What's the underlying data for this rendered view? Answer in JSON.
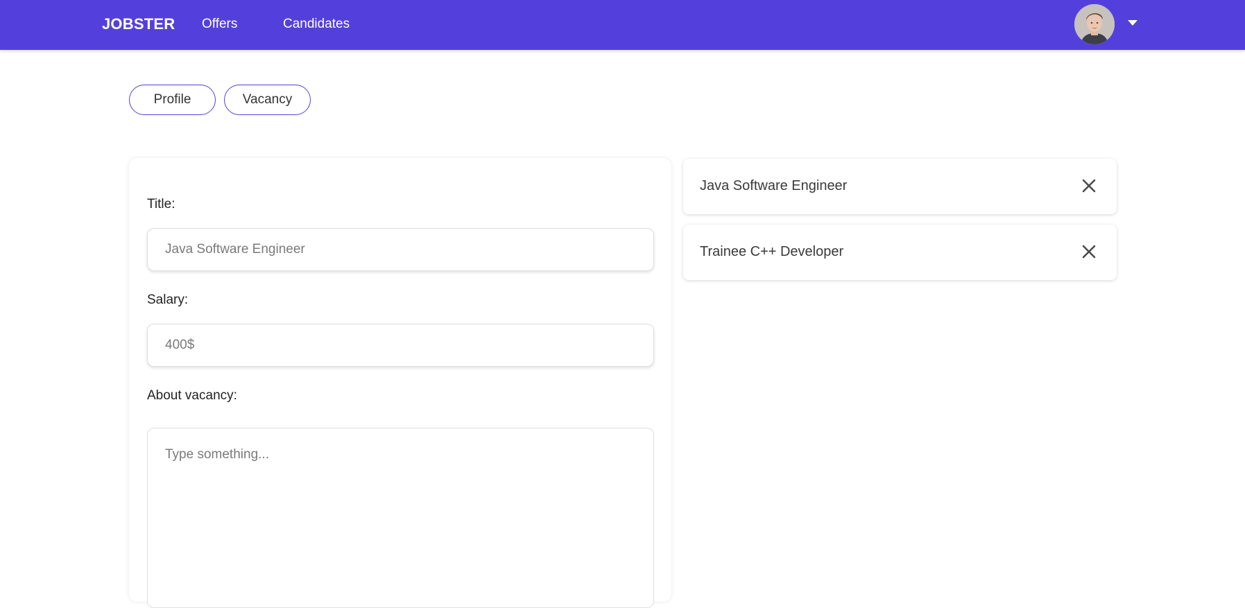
{
  "navbar": {
    "brand": "JOBSTER",
    "links": [
      "Offers",
      "Candidates"
    ],
    "accent_color": "#5340dc",
    "avatar_icon": "user-avatar",
    "menu_icon": "caret-down-icon"
  },
  "tabs": {
    "profile": "Profile",
    "vacancy": "Vacancy"
  },
  "form": {
    "title_label": "Title:",
    "title_placeholder": "Java Software Engineer",
    "salary_label": "Salary:",
    "salary_placeholder": "400$",
    "about_label": "About vacancy:",
    "about_placeholder": "Type something..."
  },
  "vacancies": [
    {
      "title": "Java Software Engineer",
      "remove_icon": "close-icon"
    },
    {
      "title": "Trainee C++ Developer",
      "remove_icon": "close-icon"
    }
  ]
}
